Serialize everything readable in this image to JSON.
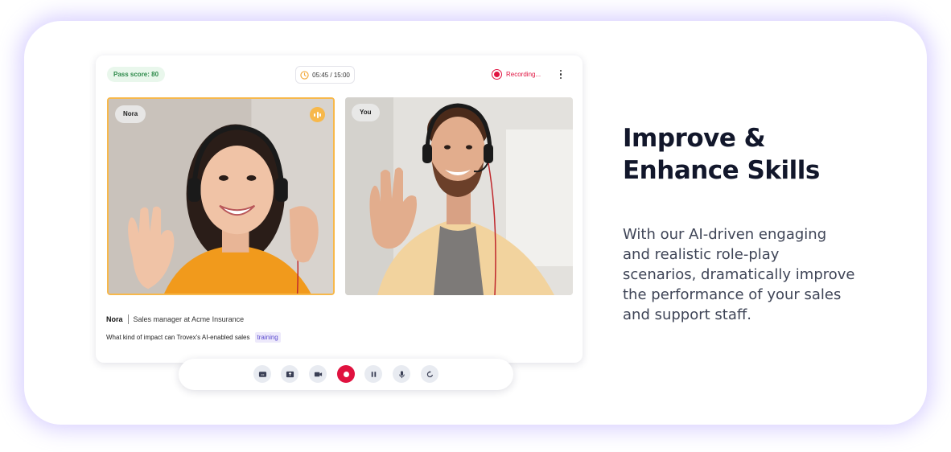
{
  "call": {
    "pass_score": "Pass score: 80",
    "timer": "05:45 / 15:00",
    "recording_label": "Recording...",
    "participants": [
      {
        "name": "Nora"
      },
      {
        "name": "You"
      }
    ]
  },
  "transcript": {
    "speaker_name": "Nora",
    "speaker_role": "Sales manager at Acme Insurance",
    "text": "What kind of impact can Trovex's AI-enabled sales",
    "highlight": "training"
  },
  "controls": [
    {
      "icon": "captions-icon"
    },
    {
      "icon": "share-screen-icon"
    },
    {
      "icon": "video-camera-icon"
    },
    {
      "icon": "record-icon"
    },
    {
      "icon": "pause-icon"
    },
    {
      "icon": "microphone-icon"
    },
    {
      "icon": "restart-icon"
    }
  ],
  "hero": {
    "title_line1": "Improve &",
    "title_line2": "Enhance Skills",
    "description": "With our AI-driven engaging and realistic role-play scenarios, dramatically improve the performance of your sales and support staff."
  },
  "colors": {
    "accent_record": "#e0123f",
    "speaking_highlight": "#f7b84b",
    "pass_green": "#2d8a4a",
    "card_glow": "#a896ff"
  }
}
